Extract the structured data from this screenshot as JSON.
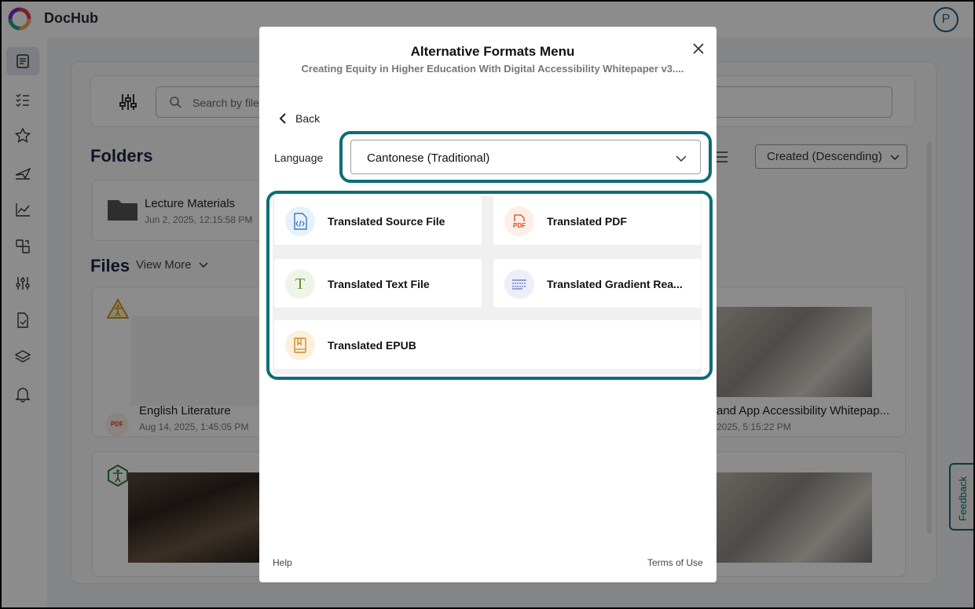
{
  "app": {
    "brand": "DocHub",
    "user_initial": "P"
  },
  "search": {
    "placeholder": "Search by file"
  },
  "sections": {
    "folders_title": "Folders",
    "files_title": "Files",
    "view_more": "View More"
  },
  "sort": {
    "selected": "Created (Descending)"
  },
  "folders": [
    {
      "name": "Lecture Materials",
      "date": "Jun 2, 2025, 12:15:58 PM"
    }
  ],
  "files": [
    {
      "name": "English Literature",
      "date": "Aug 14, 2025, 1:45:05 PM",
      "type_badge": "PDF"
    },
    {
      "name": "and App Accessibility Whitepap...",
      "date": "2025, 5:15:22 PM"
    }
  ],
  "feedback": {
    "label": "Feedback"
  },
  "modal": {
    "title": "Alternative Formats Menu",
    "subtitle": "Creating Equity in Higher Education With Digital Accessibility Whitepaper v3....",
    "back_label": "Back",
    "language_label": "Language",
    "language_value": "Cantonese (Traditional)",
    "options": [
      {
        "label": "Translated Source File",
        "icon": "code-file-icon"
      },
      {
        "label": "Translated PDF",
        "icon": "pdf-icon",
        "icon_text": "PDF"
      },
      {
        "label": "Translated Text File",
        "icon": "text-t-icon",
        "icon_text": "T"
      },
      {
        "label": "Translated Gradient Rea...",
        "icon": "gradient-lines-icon"
      },
      {
        "label": "Translated EPUB",
        "icon": "book-icon"
      }
    ],
    "help_label": "Help",
    "terms_label": "Terms of Use"
  },
  "colors": {
    "highlight": "#0d6d76",
    "brand_text": "#2b2b3a",
    "heading": "#20234a",
    "pdf_red": "#d9481f"
  }
}
